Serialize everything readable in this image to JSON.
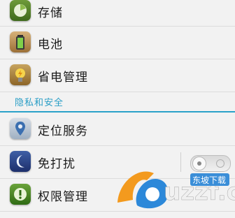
{
  "settings": {
    "items": [
      {
        "label": "存储",
        "icon": "storage-icon"
      },
      {
        "label": "电池",
        "icon": "battery-icon"
      },
      {
        "label": "省电管理",
        "icon": "power-saving-icon"
      }
    ],
    "section_title": "隐私和安全",
    "privacy_items": [
      {
        "label": "定位服务",
        "icon": "location-icon"
      },
      {
        "label": "免打扰",
        "icon": "do-not-disturb-icon",
        "toggle_on": false
      },
      {
        "label": "权限管理",
        "icon": "permission-icon"
      }
    ]
  },
  "watermark": {
    "brand": "uzzf.com",
    "tagline": "东坡下载"
  },
  "colors": {
    "accent": "#2aa2c9",
    "background": "#f2f2f2"
  }
}
